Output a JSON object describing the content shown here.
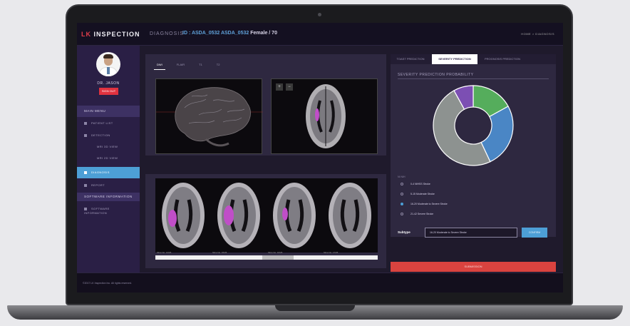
{
  "app": {
    "logo_prefix": "LK",
    "logo_suffix": "INSPECTION",
    "page_title": "DIAGNOSIS",
    "patient_id_label": "ID : ASDA_0532",
    "patient_name": "ASDA_0532",
    "patient_info": "Female / 70",
    "breadcrumb": "HOME > DIAGNOSIS"
  },
  "sidebar": {
    "doctor_name": "DR. JASON",
    "signout_label": "SIGN OUT",
    "main_menu": "MAIN MENU",
    "items": [
      {
        "label": "PATIENT LIST"
      },
      {
        "label": "DETECTION"
      },
      {
        "label": "MRI 3D VIEW"
      },
      {
        "label": "MRI 2D VIEW"
      },
      {
        "label": "DIAGNOSIS"
      },
      {
        "label": "REPORT"
      }
    ],
    "software_section": "SOFTWARE INFORMATION",
    "software_item": "SOFTWARE INFORMATION"
  },
  "viewer": {
    "tabs": [
      {
        "label": "DWI",
        "active": true
      },
      {
        "label": "FLAIR",
        "active": false
      },
      {
        "label": "T1",
        "active": false
      },
      {
        "label": "T2",
        "active": false
      }
    ],
    "zoom_in": "+",
    "zoom_out": "−",
    "slice_labels": [
      "Slice No. 14/25",
      "Slice No. 15/25",
      "Slice No. 16/25",
      "Slice No. 17/25"
    ],
    "scroll_position": 0.56
  },
  "prediction": {
    "tabs": [
      {
        "label": "TOAST PREDICTION",
        "active": false
      },
      {
        "label": "SEVERITY PREDICTION",
        "active": true
      },
      {
        "label": "PROGNOSIS PREDICTION",
        "active": false
      }
    ],
    "title": "SEVERITY PREDICTION PROBABILITY",
    "legend_header": "NI       NIH",
    "classes": [
      {
        "label": "0-4 NIHSS Stroke",
        "color": "#55ad5c",
        "value": 0.17,
        "selected": false
      },
      {
        "label": "5-15 Moderate Stroke",
        "color": "#4a86c5",
        "value": 0.26,
        "selected": false
      },
      {
        "label": "16-20 Moderate to Severe Stroke",
        "color": "#8d9290",
        "value": 0.49,
        "selected": true
      },
      {
        "label": "21-42 Severe Stroke",
        "color": "#7c4fb3",
        "value": 0.08,
        "selected": false
      }
    ],
    "subtype_label": "Subtype",
    "subtype_value": "16-20 Moderate to Severe Stroke",
    "confirm_label": "CONFIRM",
    "submit_label": "SUBMISSION"
  },
  "footer": {
    "copyright": "©2017 LK Inspection Inc. All rights reserved."
  }
}
